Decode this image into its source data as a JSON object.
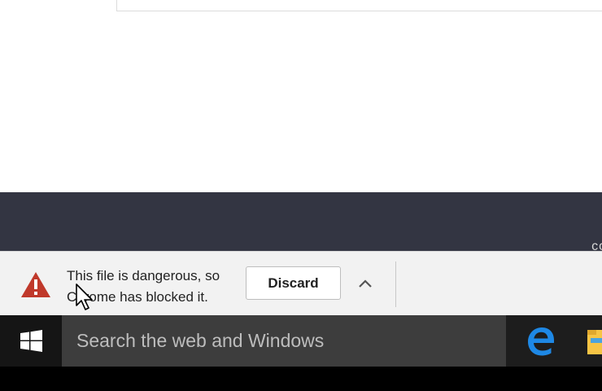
{
  "download_bar": {
    "warning_text": "This file is dangerous, so Chrome has blocked it.",
    "discard_label": "Discard",
    "warning_color": "#c0392b"
  },
  "dark_band": {
    "edge_text": "co"
  },
  "taskbar": {
    "search_placeholder": "Search the web and Windows",
    "edge_color": "#1e88e5",
    "explorer_color": "#f6c445"
  },
  "icons": [
    "warning-icon",
    "chevron-up-icon",
    "mouse-cursor-icon",
    "windows-logo-icon",
    "edge-browser-icon",
    "file-explorer-icon"
  ]
}
